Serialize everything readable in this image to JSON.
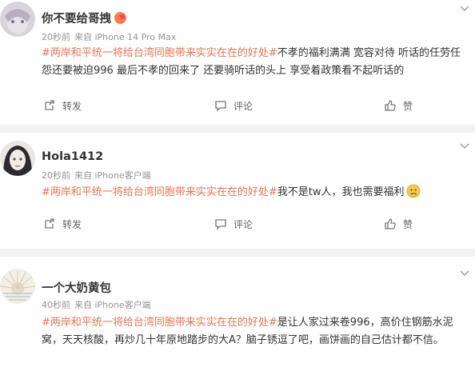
{
  "posts": [
    {
      "username": "你不要给哥拽",
      "time": "20秒前",
      "source": "来自 iPhone 14 Pro Max",
      "hashtag": "#两岸和平统一将给台湾同胞带来实实在在的好处#",
      "body": "不孝的福利满满 宽容对待 听话的任劳任怨还要被迫996 最后不孝的回来了 还要骑听话的头上 享受着政策看不起听话的",
      "repost_label": "转发",
      "comment_label": "评论",
      "like_label": "赞"
    },
    {
      "username": "Hola1412",
      "time": "20秒前",
      "source": "来自 iPhone客户端",
      "hashtag": "#两岸和平统一将给台湾同胞带来实实在在的好处#",
      "body": "我不是tw人，我也需要福利",
      "emoji_icon": "sad-face-icon",
      "repost_label": "转发",
      "comment_label": "评论",
      "like_label": "赞"
    },
    {
      "username": "一个大奶黄包",
      "time": "40秒前",
      "source": "来自 iPhone客户端",
      "hashtag": "#两岸和平统一将给台湾同胞带来实实在在的好处#",
      "body": "是让人家过来卷996，高价住钢筋水泥窝，天天核酸，再炒几十年原地踏步的大A？脑子锈逗了吧，画饼画的自己估计都不信。"
    }
  ],
  "colors": {
    "hashtag": "#eb7350",
    "text": "#333333",
    "meta": "#939393",
    "separator": "#f2f2f2"
  }
}
